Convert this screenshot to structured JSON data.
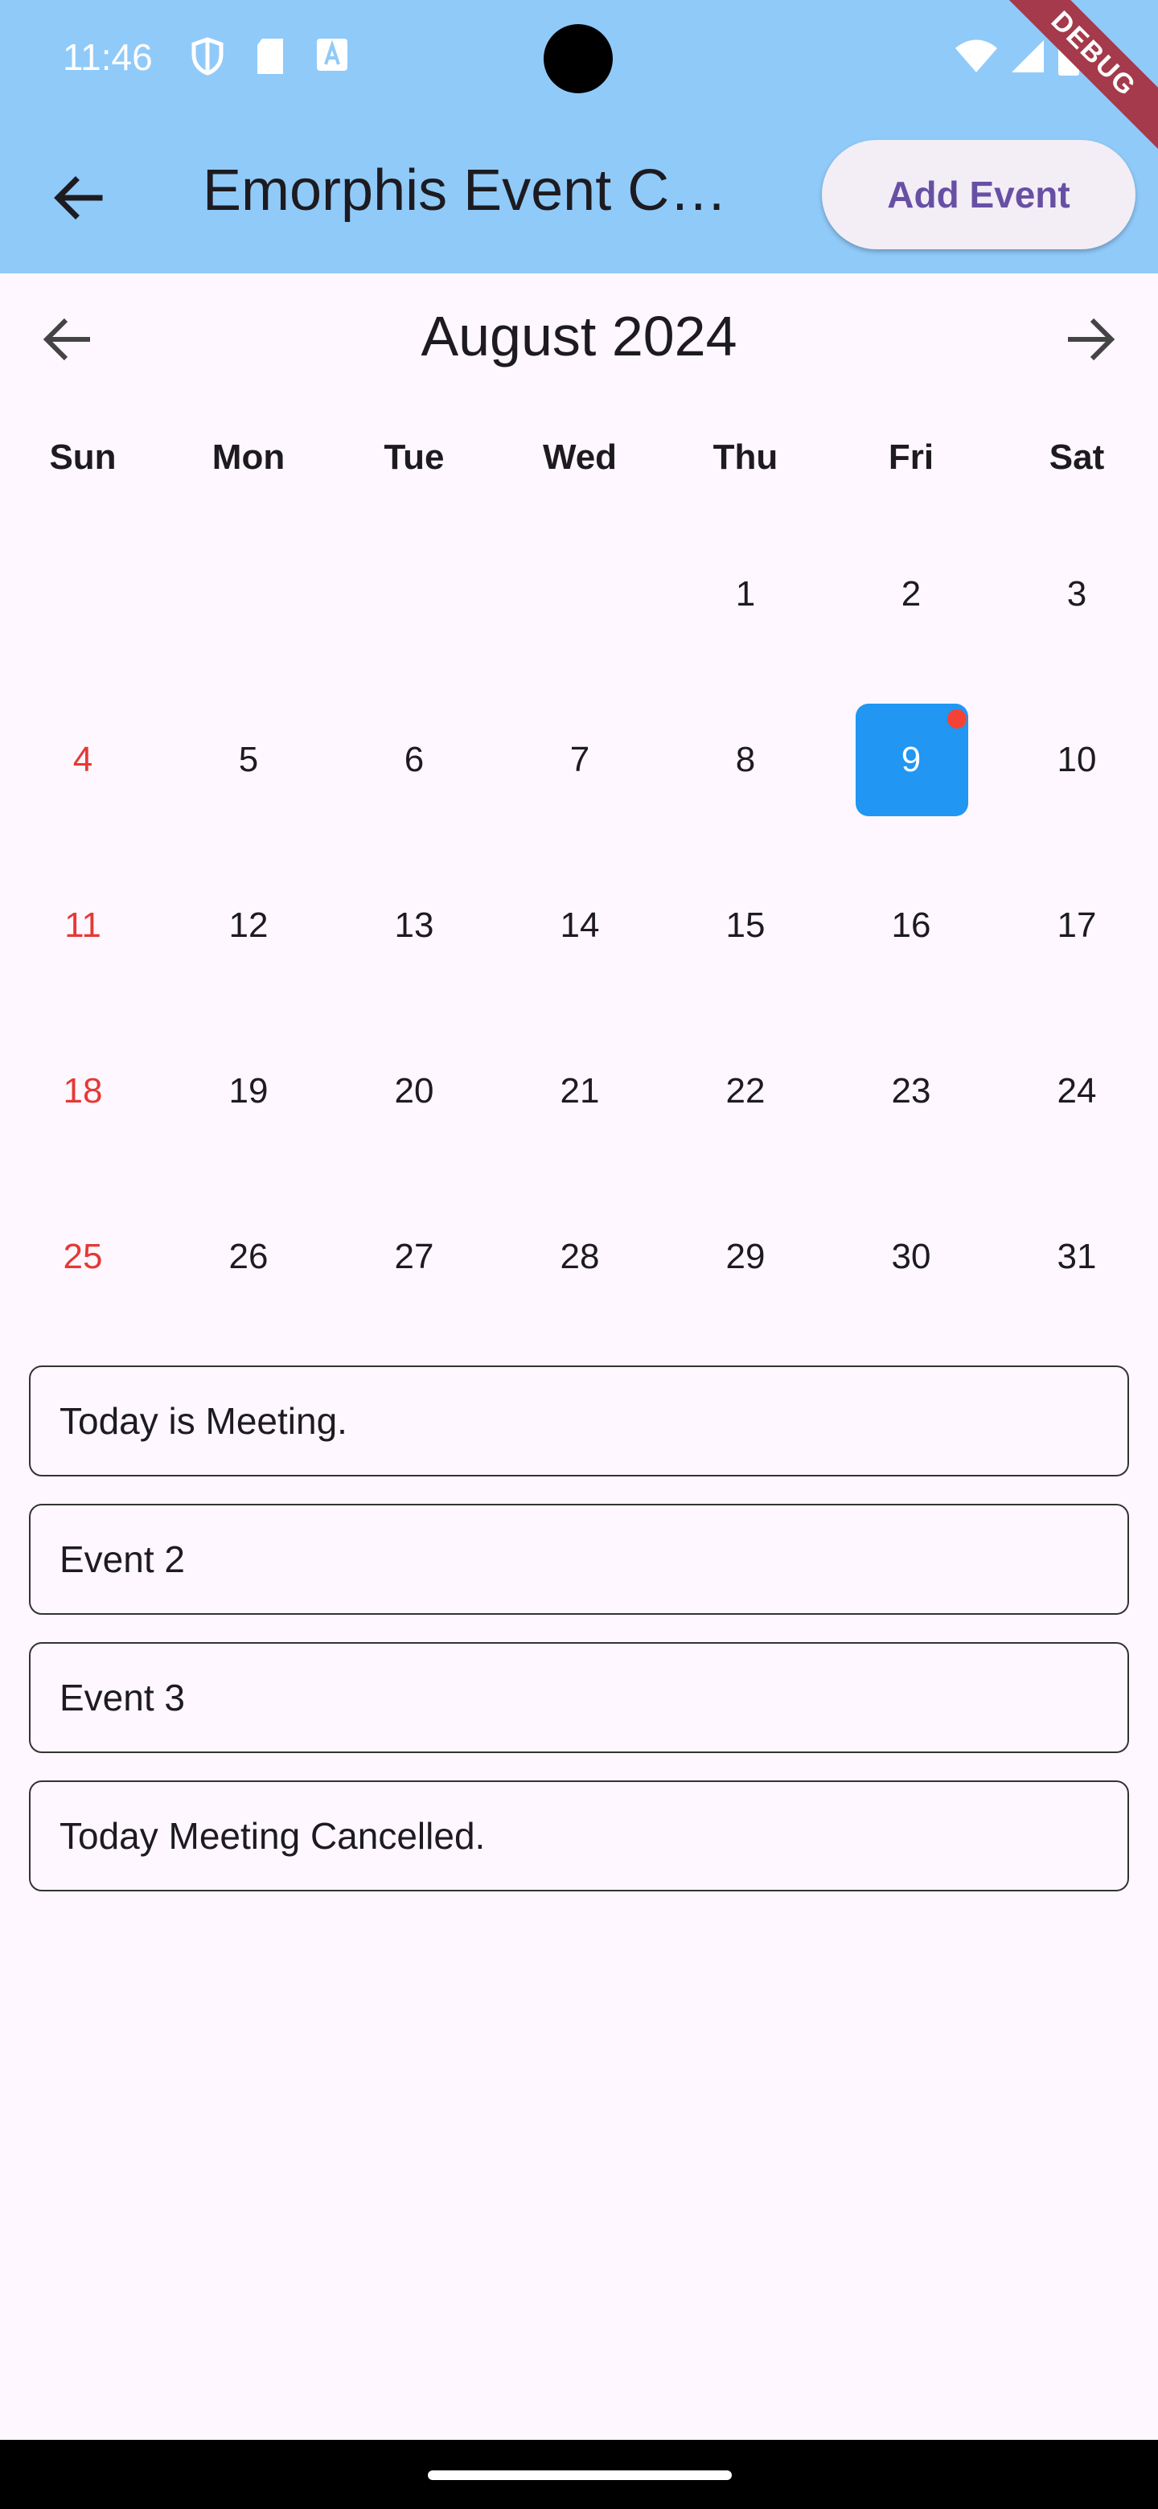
{
  "status_bar": {
    "time": "11:46",
    "icons": [
      "shield-icon",
      "sd-card-icon",
      "font-a-icon",
      "wifi-icon",
      "signal-icon",
      "battery-icon"
    ]
  },
  "app_bar": {
    "title": "Emorphis Event C…",
    "add_button_label": "Add Event",
    "debug_banner": "DEBUG"
  },
  "calendar": {
    "month_title": "August 2024",
    "weekdays": [
      "Sun",
      "Mon",
      "Tue",
      "Wed",
      "Thu",
      "Fri",
      "Sat"
    ],
    "first_weekday_index": 4,
    "days_in_month": 31,
    "selected_day": 9,
    "event_marker_day": 9,
    "weekend_color": "#e53935",
    "selected_color": "#2196f3"
  },
  "events": [
    {
      "label": "Today is Meeting."
    },
    {
      "label": "Event 2"
    },
    {
      "label": "Event 3"
    },
    {
      "label": "Today Meeting Cancelled."
    }
  ],
  "colors": {
    "app_bar": "#90caf9",
    "background": "#fef7ff",
    "button_text": "#6750a4"
  }
}
